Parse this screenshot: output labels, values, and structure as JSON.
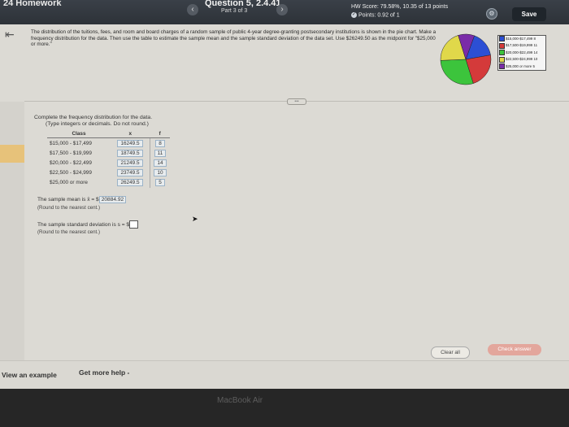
{
  "header": {
    "title": "24 Homework",
    "prev_label": "‹",
    "next_label": "›",
    "question_title": "Question 5, 2.4.41",
    "question_part": "Part 3 of 3",
    "score": "HW Score: 79.58%, 10.35 of 13 points",
    "points": "Points: 0.92 of 1",
    "save_label": "Save"
  },
  "problem": {
    "description": "The distribution of the tuitions, fees, and room and board charges of a random sample of public 4-year degree-granting postsecondary institutions is shown in the pie chart. Make a frequency distribution for the data. Then use the table to estimate the sample mean and the sample standard deviation of the data set. Use $26249.50 as the midpoint for \"$25,000 or more.\"",
    "instruction_line1": "Complete the frequency distribution for the data.",
    "instruction_line2": "(Type integers or decimals. Do not round.)"
  },
  "table": {
    "headers": [
      "Class",
      "x",
      "f"
    ],
    "rows": [
      {
        "class": "$15,000 - $17,499",
        "x": "16249.5",
        "f": "8"
      },
      {
        "class": "$17,500 - $19,999",
        "x": "18749.5",
        "f": "11"
      },
      {
        "class": "$20,000 - $22,499",
        "x": "21249.5",
        "f": "14"
      },
      {
        "class": "$22,500 - $24,999",
        "x": "23749.5",
        "f": "10"
      },
      {
        "class": "$25,000 or more",
        "x": "26249.5",
        "f": "5"
      }
    ]
  },
  "answers": {
    "mean_prefix": "The sample mean is x̄ = $",
    "mean_value": "20884.92",
    "mean_round": "(Round to the nearest cent.)",
    "sd_prefix": "The sample standard deviation is s = $",
    "sd_round": "(Round to the nearest cent.)"
  },
  "chart_data": {
    "type": "pie",
    "categories": [
      "$15,000-$17,499",
      "$17,500-$19,999",
      "$20,000-$22,499",
      "$22,500-$24,999",
      "$25,000 or more"
    ],
    "values": [
      8,
      11,
      14,
      10,
      5
    ],
    "colors": [
      "#2c4fd4",
      "#d43a3a",
      "#3cc43c",
      "#e0d84a",
      "#7a2ca8"
    ]
  },
  "legend": {
    "items": [
      {
        "label": "$15,000-$17,499",
        "count": "8",
        "color": "#2c4fd4"
      },
      {
        "label": "$17,500-$19,999",
        "count": "11",
        "color": "#d43a3a"
      },
      {
        "label": "$20,000-$22,499",
        "count": "14",
        "color": "#3cc43c"
      },
      {
        "label": "$22,500-$24,999",
        "count": "10",
        "color": "#e0d84a"
      },
      {
        "label": "$25,000 or more",
        "count": "5",
        "color": "#7a2ca8"
      }
    ]
  },
  "footer": {
    "view_example": "View an example",
    "get_help": "Get more help -",
    "clear_all": "Clear all",
    "check_answer": "Check answer"
  },
  "bezel": {
    "label": "MacBook Air"
  }
}
